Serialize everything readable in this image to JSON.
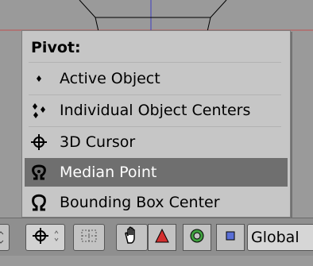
{
  "menu": {
    "title": "Pivot:",
    "items": [
      {
        "label": "Active Object",
        "icon": "dot-icon",
        "selected": false
      },
      {
        "label": "Individual Object Centers",
        "icon": "individual-centers-icon",
        "selected": false
      },
      {
        "label": "3D Cursor",
        "icon": "crosshair-cursor-icon",
        "selected": false
      },
      {
        "label": "Median Point",
        "icon": "median-point-icon",
        "selected": true
      },
      {
        "label": "Bounding Box Center",
        "icon": "bounding-box-icon",
        "selected": false
      }
    ]
  },
  "toolbar": {
    "orientation_label": "Global",
    "icons": [
      "pivot-crosshair-icon",
      "snap-grid-icon",
      "hand-manipulator-icon",
      "translate-icon",
      "rotate-icon",
      "scale-icon"
    ]
  },
  "colors": {
    "menu_bg": "#c6c6c6",
    "selected_bg": "#6f6f6f",
    "toolbar_bg": "#8f8f8f",
    "translate_red": "#d43030",
    "rotate_green": "#3fa03f",
    "scale_blue": "#5a6fd6"
  }
}
